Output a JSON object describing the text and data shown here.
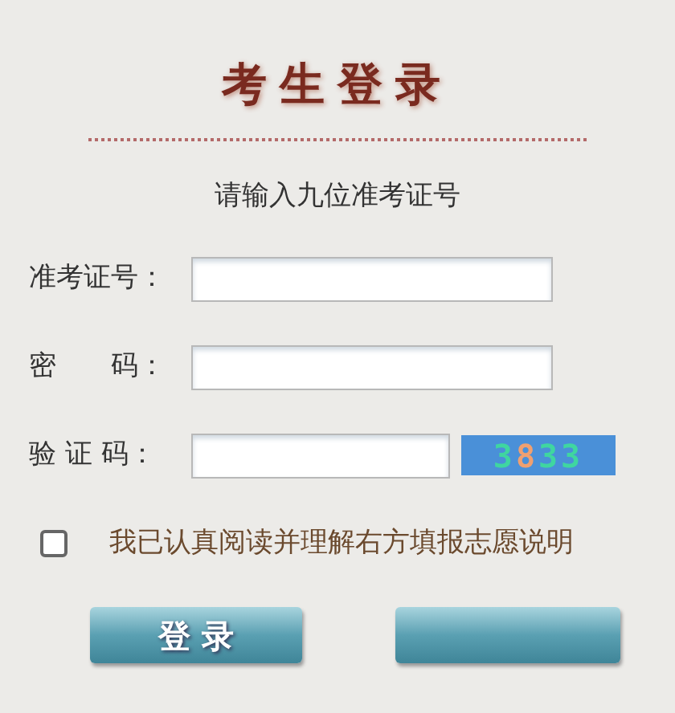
{
  "title": "考生登录",
  "subtitle": "请输入九位准考证号",
  "fields": [
    {
      "label": "准考证号：",
      "kind": "text"
    },
    {
      "label": "密　　码：",
      "kind": "password"
    },
    {
      "label": "验 证 码：",
      "kind": "captcha",
      "captcha": "3833"
    }
  ],
  "agreement": {
    "label": "我已认真阅读并理解右方填报志愿说明",
    "checked": false
  },
  "buttons": [
    {
      "label": "登 录"
    },
    {
      "kind": "blank"
    }
  ]
}
